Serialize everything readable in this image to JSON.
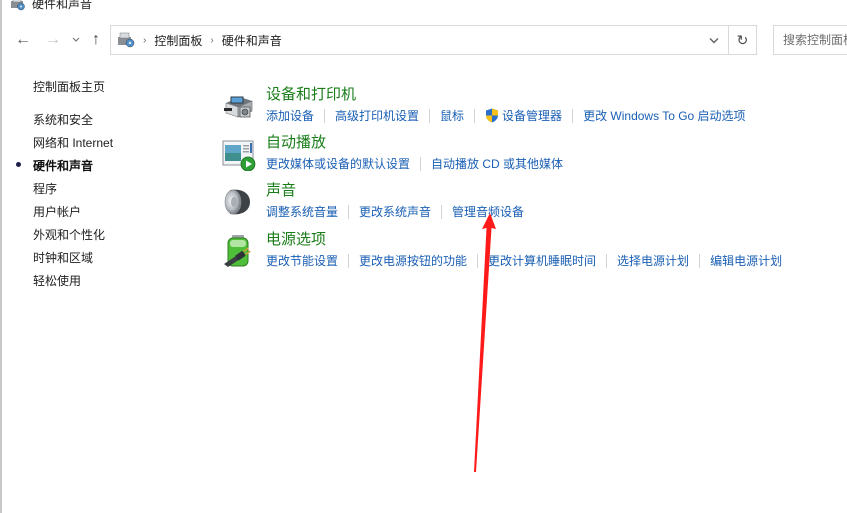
{
  "window": {
    "title": "硬件和声音",
    "title_icon": "control-panel-hardware-icon"
  },
  "nav": {
    "back_icon": "←",
    "forward_icon": "→",
    "recent_icon": "⌄",
    "up_icon": "↑",
    "breadcrumb": [
      "控制面板",
      "硬件和声音"
    ],
    "crumb_separator": "›",
    "dropdown_icon": "⌄",
    "refresh_icon": "↻",
    "search_placeholder": "搜索控制面板"
  },
  "sidebar": {
    "home": "控制面板主页",
    "items": [
      {
        "label": "系统和安全",
        "active": false
      },
      {
        "label": "网络和 Internet",
        "active": false
      },
      {
        "label": "硬件和声音",
        "active": true
      },
      {
        "label": "程序",
        "active": false
      },
      {
        "label": "用户帐户",
        "active": false
      },
      {
        "label": "外观和个性化",
        "active": false
      },
      {
        "label": "时钟和区域",
        "active": false
      },
      {
        "label": "轻松使用",
        "active": false
      }
    ]
  },
  "categories": [
    {
      "title": "设备和打印机",
      "icon": "printer-device-icon",
      "links": [
        "添加设备",
        "高级打印机设置",
        "鼠标",
        "设备管理器",
        "更改 Windows To Go 启动选项"
      ]
    },
    {
      "title": "自动播放",
      "icon": "autoplay-icon",
      "links": [
        "更改媒体或设备的默认设置",
        "自动播放 CD 或其他媒体"
      ]
    },
    {
      "title": "声音",
      "icon": "speaker-icon",
      "links": [
        "调整系统音量",
        "更改系统声音",
        "管理音频设备"
      ]
    },
    {
      "title": "电源选项",
      "icon": "battery-power-icon",
      "links": [
        "更改节能设置",
        "更改电源按钮的功能",
        "更改计算机睡眠时间",
        "选择电源计划",
        "编辑电源计划"
      ]
    }
  ],
  "colors": {
    "category_title": "#1a7d1a",
    "link": "#1a5fb4",
    "annotation_arrow": "#ff1a1a"
  },
  "annotation": {
    "type": "red-arrow",
    "points_to": "管理音频设备"
  }
}
